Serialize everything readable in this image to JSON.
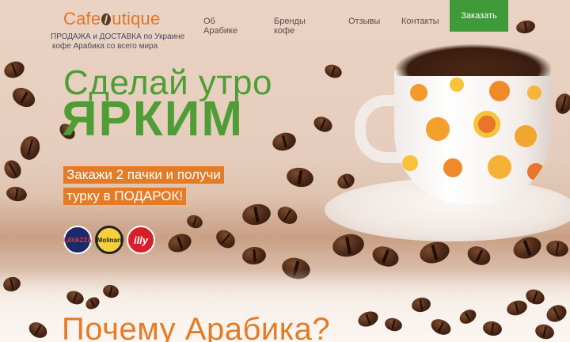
{
  "header": {
    "logo_text_left": "Cafe",
    "logo_text_right": "utique",
    "tagline_line1": "ПРОДАЖА и ДОСТАВКА по Украине",
    "tagline_line2": "кофе Арабика со всего мира",
    "nav": [
      {
        "label": "Об Арабике"
      },
      {
        "label": "Бренды кофе"
      },
      {
        "label": "Отзывы"
      },
      {
        "label": "Контакты"
      }
    ],
    "cta_label": "Заказать"
  },
  "hero": {
    "title_line1": "Сделай утро",
    "title_line2": "ЯРКИМ",
    "promo_line1": "Закажи 2 пачки и получи",
    "promo_line2": "турку в ПОДАРОК!"
  },
  "brands": [
    {
      "name": "Lavazza",
      "badge": "LAVAZZA"
    },
    {
      "name": "Molinari",
      "badge": "Molinari"
    },
    {
      "name": "illy",
      "badge": "illy"
    }
  ],
  "section": {
    "title": "Почему Арабика?"
  },
  "colors": {
    "accent_orange": "#e47b26",
    "brand_green": "#4e9e35",
    "cta_green": "#3f9b3a"
  }
}
